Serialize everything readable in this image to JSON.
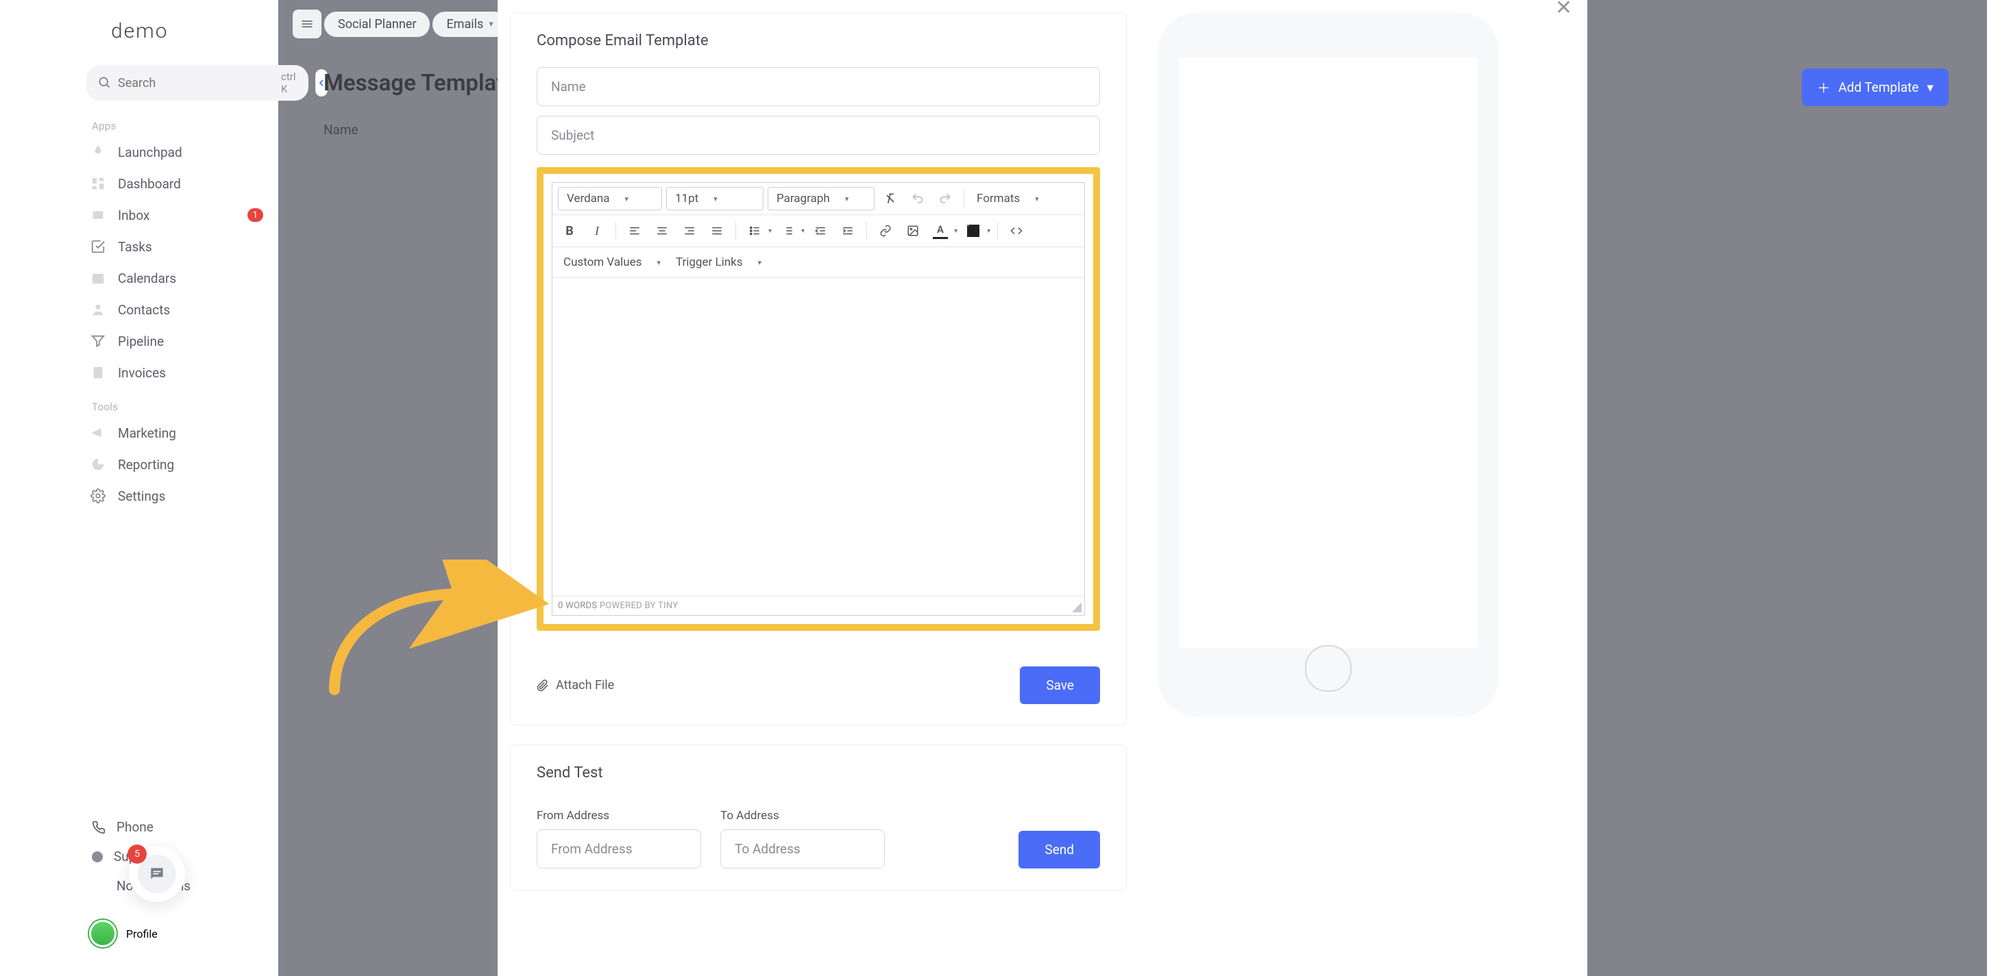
{
  "logo": "demo",
  "search": {
    "placeholder": "Search",
    "kbd": "ctrl K"
  },
  "side_section_apps": "Apps",
  "side_section_tools": "Tools",
  "sidebar": {
    "items": [
      {
        "label": "Launchpad"
      },
      {
        "label": "Dashboard"
      },
      {
        "label": "Inbox",
        "badge": "1"
      },
      {
        "label": "Tasks"
      },
      {
        "label": "Calendars"
      },
      {
        "label": "Contacts"
      },
      {
        "label": "Pipeline"
      },
      {
        "label": "Invoices"
      }
    ],
    "tools": [
      {
        "label": "Marketing"
      },
      {
        "label": "Reporting"
      },
      {
        "label": "Settings"
      }
    ]
  },
  "bottom": {
    "phone": "Phone",
    "support": "Support",
    "notifications": "Notifications",
    "profile": "Profile",
    "notif_count": "5"
  },
  "topnav": {
    "social": "Social Planner",
    "emails": "Emails"
  },
  "page": {
    "title": "Message Templates",
    "name_col": "Name",
    "add_template": "Add Template"
  },
  "modal": {
    "compose_title": "Compose Email Template",
    "name_ph": "Name",
    "subject_ph": "Subject",
    "font": "Verdana",
    "font_size": "11pt",
    "block": "Paragraph",
    "formats": "Formats",
    "custom_values": "Custom Values",
    "trigger_links": "Trigger Links",
    "word_count": "0 WORDS",
    "powered": "POWERED BY TINY",
    "attach": "Attach File",
    "save": "Save"
  },
  "sendtest": {
    "title": "Send Test",
    "from_label": "From Address",
    "from_ph": "From Address",
    "to_label": "To Address",
    "to_ph": "To Address",
    "send": "Send"
  },
  "colors": {
    "accent": "#4a6cf7",
    "highlight": "#f5c342",
    "danger": "#e8443f"
  }
}
